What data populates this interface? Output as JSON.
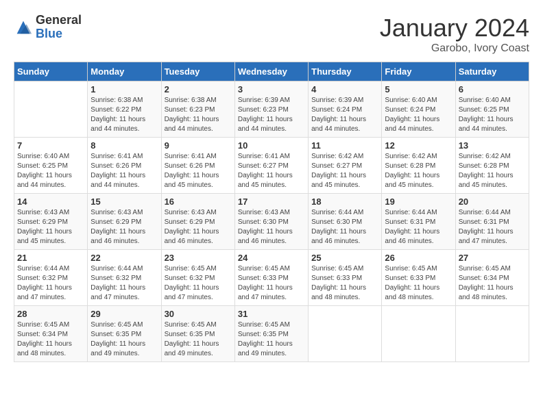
{
  "header": {
    "logo_general": "General",
    "logo_blue": "Blue",
    "month_title": "January 2024",
    "location": "Garobo, Ivory Coast"
  },
  "weekdays": [
    "Sunday",
    "Monday",
    "Tuesday",
    "Wednesday",
    "Thursday",
    "Friday",
    "Saturday"
  ],
  "weeks": [
    [
      {
        "day": "",
        "sunrise": "",
        "sunset": "",
        "daylight": ""
      },
      {
        "day": "1",
        "sunrise": "Sunrise: 6:38 AM",
        "sunset": "Sunset: 6:22 PM",
        "daylight": "Daylight: 11 hours and 44 minutes."
      },
      {
        "day": "2",
        "sunrise": "Sunrise: 6:38 AM",
        "sunset": "Sunset: 6:23 PM",
        "daylight": "Daylight: 11 hours and 44 minutes."
      },
      {
        "day": "3",
        "sunrise": "Sunrise: 6:39 AM",
        "sunset": "Sunset: 6:23 PM",
        "daylight": "Daylight: 11 hours and 44 minutes."
      },
      {
        "day": "4",
        "sunrise": "Sunrise: 6:39 AM",
        "sunset": "Sunset: 6:24 PM",
        "daylight": "Daylight: 11 hours and 44 minutes."
      },
      {
        "day": "5",
        "sunrise": "Sunrise: 6:40 AM",
        "sunset": "Sunset: 6:24 PM",
        "daylight": "Daylight: 11 hours and 44 minutes."
      },
      {
        "day": "6",
        "sunrise": "Sunrise: 6:40 AM",
        "sunset": "Sunset: 6:25 PM",
        "daylight": "Daylight: 11 hours and 44 minutes."
      }
    ],
    [
      {
        "day": "7",
        "sunrise": "Sunrise: 6:40 AM",
        "sunset": "Sunset: 6:25 PM",
        "daylight": "Daylight: 11 hours and 44 minutes."
      },
      {
        "day": "8",
        "sunrise": "Sunrise: 6:41 AM",
        "sunset": "Sunset: 6:26 PM",
        "daylight": "Daylight: 11 hours and 44 minutes."
      },
      {
        "day": "9",
        "sunrise": "Sunrise: 6:41 AM",
        "sunset": "Sunset: 6:26 PM",
        "daylight": "Daylight: 11 hours and 45 minutes."
      },
      {
        "day": "10",
        "sunrise": "Sunrise: 6:41 AM",
        "sunset": "Sunset: 6:27 PM",
        "daylight": "Daylight: 11 hours and 45 minutes."
      },
      {
        "day": "11",
        "sunrise": "Sunrise: 6:42 AM",
        "sunset": "Sunset: 6:27 PM",
        "daylight": "Daylight: 11 hours and 45 minutes."
      },
      {
        "day": "12",
        "sunrise": "Sunrise: 6:42 AM",
        "sunset": "Sunset: 6:28 PM",
        "daylight": "Daylight: 11 hours and 45 minutes."
      },
      {
        "day": "13",
        "sunrise": "Sunrise: 6:42 AM",
        "sunset": "Sunset: 6:28 PM",
        "daylight": "Daylight: 11 hours and 45 minutes."
      }
    ],
    [
      {
        "day": "14",
        "sunrise": "Sunrise: 6:43 AM",
        "sunset": "Sunset: 6:29 PM",
        "daylight": "Daylight: 11 hours and 45 minutes."
      },
      {
        "day": "15",
        "sunrise": "Sunrise: 6:43 AM",
        "sunset": "Sunset: 6:29 PM",
        "daylight": "Daylight: 11 hours and 46 minutes."
      },
      {
        "day": "16",
        "sunrise": "Sunrise: 6:43 AM",
        "sunset": "Sunset: 6:29 PM",
        "daylight": "Daylight: 11 hours and 46 minutes."
      },
      {
        "day": "17",
        "sunrise": "Sunrise: 6:43 AM",
        "sunset": "Sunset: 6:30 PM",
        "daylight": "Daylight: 11 hours and 46 minutes."
      },
      {
        "day": "18",
        "sunrise": "Sunrise: 6:44 AM",
        "sunset": "Sunset: 6:30 PM",
        "daylight": "Daylight: 11 hours and 46 minutes."
      },
      {
        "day": "19",
        "sunrise": "Sunrise: 6:44 AM",
        "sunset": "Sunset: 6:31 PM",
        "daylight": "Daylight: 11 hours and 46 minutes."
      },
      {
        "day": "20",
        "sunrise": "Sunrise: 6:44 AM",
        "sunset": "Sunset: 6:31 PM",
        "daylight": "Daylight: 11 hours and 47 minutes."
      }
    ],
    [
      {
        "day": "21",
        "sunrise": "Sunrise: 6:44 AM",
        "sunset": "Sunset: 6:32 PM",
        "daylight": "Daylight: 11 hours and 47 minutes."
      },
      {
        "day": "22",
        "sunrise": "Sunrise: 6:44 AM",
        "sunset": "Sunset: 6:32 PM",
        "daylight": "Daylight: 11 hours and 47 minutes."
      },
      {
        "day": "23",
        "sunrise": "Sunrise: 6:45 AM",
        "sunset": "Sunset: 6:32 PM",
        "daylight": "Daylight: 11 hours and 47 minutes."
      },
      {
        "day": "24",
        "sunrise": "Sunrise: 6:45 AM",
        "sunset": "Sunset: 6:33 PM",
        "daylight": "Daylight: 11 hours and 47 minutes."
      },
      {
        "day": "25",
        "sunrise": "Sunrise: 6:45 AM",
        "sunset": "Sunset: 6:33 PM",
        "daylight": "Daylight: 11 hours and 48 minutes."
      },
      {
        "day": "26",
        "sunrise": "Sunrise: 6:45 AM",
        "sunset": "Sunset: 6:33 PM",
        "daylight": "Daylight: 11 hours and 48 minutes."
      },
      {
        "day": "27",
        "sunrise": "Sunrise: 6:45 AM",
        "sunset": "Sunset: 6:34 PM",
        "daylight": "Daylight: 11 hours and 48 minutes."
      }
    ],
    [
      {
        "day": "28",
        "sunrise": "Sunrise: 6:45 AM",
        "sunset": "Sunset: 6:34 PM",
        "daylight": "Daylight: 11 hours and 48 minutes."
      },
      {
        "day": "29",
        "sunrise": "Sunrise: 6:45 AM",
        "sunset": "Sunset: 6:35 PM",
        "daylight": "Daylight: 11 hours and 49 minutes."
      },
      {
        "day": "30",
        "sunrise": "Sunrise: 6:45 AM",
        "sunset": "Sunset: 6:35 PM",
        "daylight": "Daylight: 11 hours and 49 minutes."
      },
      {
        "day": "31",
        "sunrise": "Sunrise: 6:45 AM",
        "sunset": "Sunset: 6:35 PM",
        "daylight": "Daylight: 11 hours and 49 minutes."
      },
      {
        "day": "",
        "sunrise": "",
        "sunset": "",
        "daylight": ""
      },
      {
        "day": "",
        "sunrise": "",
        "sunset": "",
        "daylight": ""
      },
      {
        "day": "",
        "sunrise": "",
        "sunset": "",
        "daylight": ""
      }
    ]
  ]
}
